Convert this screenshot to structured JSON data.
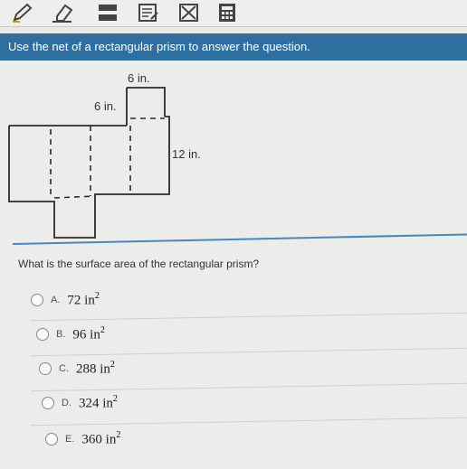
{
  "toolbar": {
    "tools": [
      "pencil-icon",
      "eraser-icon",
      "line-reader-icon",
      "notepad-icon",
      "eliminate-icon",
      "calculator-icon"
    ]
  },
  "question": {
    "instruction": "Use the net of a rectangular prism to answer the question.",
    "prompt": "What is the surface area of the rectangular prism?"
  },
  "net": {
    "label_top": "6 in.",
    "label_left": "6 in.",
    "label_right": "12 in."
  },
  "options": [
    {
      "letter": "A.",
      "value": "72 in",
      "exp": "2"
    },
    {
      "letter": "B.",
      "value": "96 in",
      "exp": "2"
    },
    {
      "letter": "C.",
      "value": "288 in",
      "exp": "2"
    },
    {
      "letter": "D.",
      "value": "324 in",
      "exp": "2"
    },
    {
      "letter": "E.",
      "value": "360 in",
      "exp": "2"
    }
  ]
}
